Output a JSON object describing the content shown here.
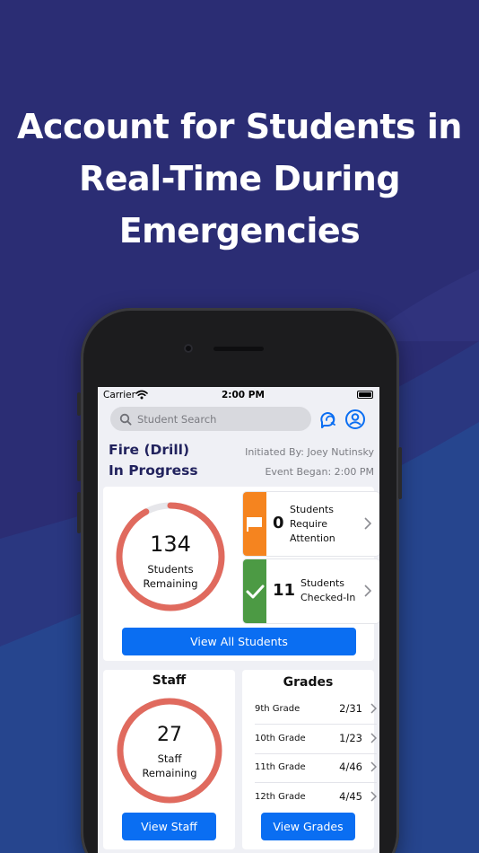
{
  "headline": [
    "Account for Students in",
    "Real-Time During",
    "Emergencies"
  ],
  "status_bar": {
    "carrier": "Carrier",
    "time": "2:00 PM"
  },
  "search": {
    "placeholder": "Student Search"
  },
  "event": {
    "title_line1": "Fire (Drill)",
    "title_line2": "In Progress",
    "initiated_by": "Initiated By: Joey Nutinsky",
    "event_began": "Event Began: 2:00 PM"
  },
  "students": {
    "remaining_count": "134",
    "remaining_label_1": "Students",
    "remaining_label_2": "Remaining",
    "remaining_fraction": 0.92,
    "attention": {
      "count": "0",
      "label_1": "Students",
      "label_2": "Require",
      "label_3": "Attention"
    },
    "checked_in": {
      "count": "11",
      "label_1": "Students",
      "label_2": "Checked-In"
    },
    "view_all_label": "View All Students"
  },
  "staff": {
    "title": "Staff",
    "remaining_count": "27",
    "remaining_label_1": "Staff",
    "remaining_label_2": "Remaining",
    "remaining_fraction": 1.0,
    "view_label": "View Staff"
  },
  "grades": {
    "title": "Grades",
    "rows": [
      {
        "name": "9th Grade",
        "value": "2/31"
      },
      {
        "name": "10th Grade",
        "value": "1/23"
      },
      {
        "name": "11th Grade",
        "value": "4/46"
      },
      {
        "name": "12th Grade",
        "value": "4/45"
      }
    ],
    "view_label": "View Grades"
  },
  "colors": {
    "background": "#2b2d74",
    "accent_blue": "#0a6ef2",
    "ring_red": "#e06a5e",
    "attention_orange": "#f5841f",
    "checked_green": "#4c9a44",
    "title_navy": "#22235e"
  },
  "icons": [
    "wifi-icon",
    "search-icon",
    "chat-bubble-icon",
    "user-profile-icon",
    "flag-icon",
    "checkmark-icon",
    "chevron-right-icon"
  ]
}
